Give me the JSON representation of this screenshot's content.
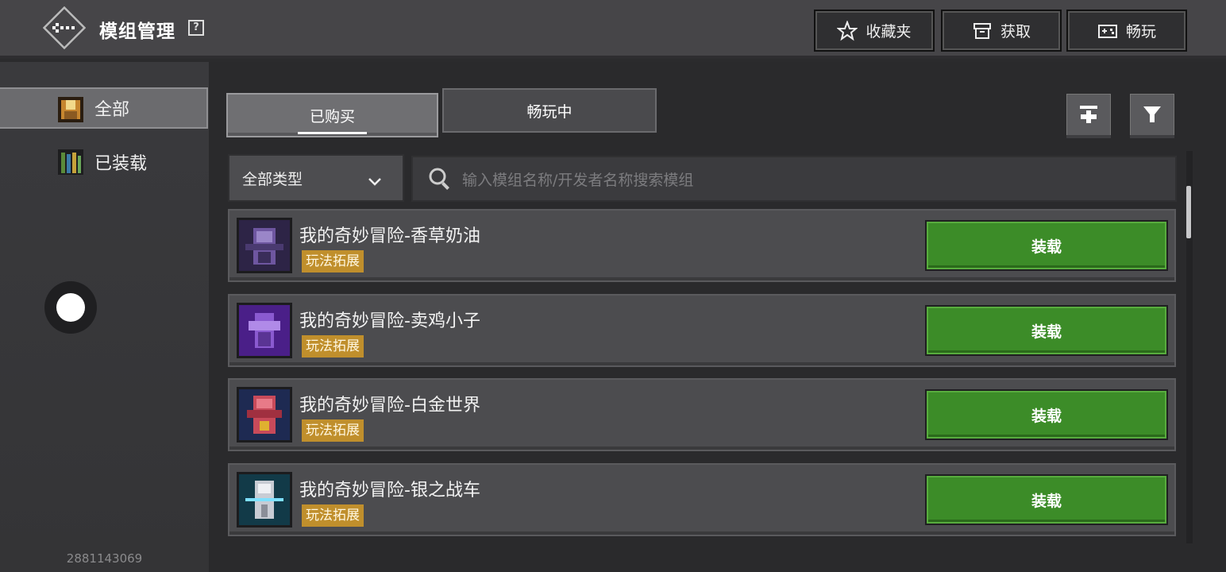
{
  "header": {
    "title": "模组管理",
    "help_icon": "?",
    "buttons": [
      {
        "label": "收藏夹",
        "icon": "star-icon"
      },
      {
        "label": "获取",
        "icon": "store-icon"
      },
      {
        "label": "畅玩",
        "icon": "gamepad-icon"
      }
    ]
  },
  "sidebar": {
    "items": [
      {
        "label": "全部",
        "icon": "all-mods-icon",
        "active": true
      },
      {
        "label": "已装载",
        "icon": "loaded-mods-icon",
        "active": false
      }
    ],
    "user_id": "2881143069"
  },
  "tabs": [
    {
      "label": "已购买",
      "active": true
    },
    {
      "label": "畅玩中",
      "active": false
    }
  ],
  "filter": {
    "type_select": "全部类型",
    "search_placeholder": "输入模组名称/开发者名称搜索模组"
  },
  "mods": [
    {
      "name": "我的奇妙冒险-香草奶油",
      "tag": "玩法拓展",
      "action": "装载",
      "thumb_color": "#5b3c8a"
    },
    {
      "name": "我的奇妙冒险-卖鸡小子",
      "tag": "玩法拓展",
      "action": "装载",
      "thumb_color": "#6a2fb0"
    },
    {
      "name": "我的奇妙冒险-白金世界",
      "tag": "玩法拓展",
      "action": "装载",
      "thumb_color": "#2a3a6c"
    },
    {
      "name": "我的奇妙冒险-银之战车",
      "tag": "玩法拓展",
      "action": "装载",
      "thumb_color": "#1a5a6a"
    }
  ],
  "colors": {
    "accent_green": "#3c8c28",
    "tag_gold": "#c08f2c"
  }
}
